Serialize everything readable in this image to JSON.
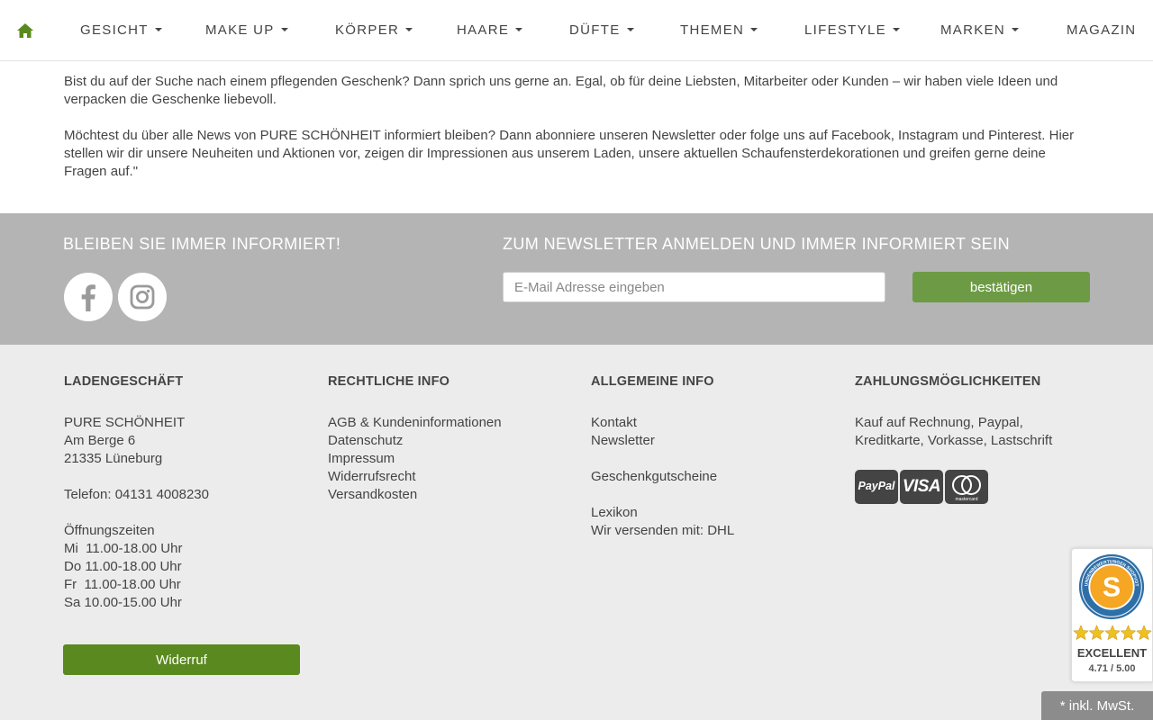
{
  "nav": {
    "home_icon": "home-icon",
    "items": [
      {
        "label": "GESICHT",
        "dropdown": true
      },
      {
        "label": "MAKE UP",
        "dropdown": true
      },
      {
        "label": "KÖRPER",
        "dropdown": true
      },
      {
        "label": "HAARE",
        "dropdown": true
      },
      {
        "label": "DÜFTE",
        "dropdown": true
      },
      {
        "label": "THEMEN",
        "dropdown": true
      },
      {
        "label": "LIFESTYLE",
        "dropdown": true
      },
      {
        "label": "MARKEN",
        "dropdown": true
      },
      {
        "label": "MAGAZIN",
        "dropdown": false
      }
    ]
  },
  "intro": {
    "paragraph1": "Bist du auf der Suche nach einem pflegenden Geschenk? Dann sprich uns gerne an. Egal, ob für deine Liebsten, Mitarbeiter oder Kunden – wir haben viele Ideen und verpacken die Geschenke liebevoll.",
    "paragraph2": "Möchtest du über alle News von PURE SCHÖNHEIT informiert bleiben? Dann abonniere unseren Newsletter oder folge uns auf Facebook, Instagram und Pinterest. Hier stellen wir dir unsere Neuheiten und Aktionen vor, zeigen dir Impressionen aus unserem Laden, unsere aktuellen Schaufensterdekorationen und greifen gerne deine Fragen auf.\""
  },
  "newsletter": {
    "left_title": "BLEIBEN SIE IMMER INFORMIERT!",
    "right_title": "ZUM NEWSLETTER ANMELDEN UND IMMER INFORMIERT SEIN",
    "email_placeholder": "E-Mail Adresse eingeben",
    "email_value": "",
    "submit_label": "bestätigen",
    "social_icons": [
      "facebook-icon",
      "instagram-icon"
    ]
  },
  "footer": {
    "store": {
      "title": "LADENGESCHÄFT",
      "name": "PURE SCHÖNHEIT",
      "street": "Am Berge 6",
      "city": "21335 Lüneburg",
      "phone": "Telefon: 04131 4008230",
      "hours_title": "Öffnungszeiten",
      "hours": [
        "Mi  11.00-18.00 Uhr",
        "Do 11.00-18.00 Uhr",
        "Fr  11.00-18.00 Uhr",
        "Sa 10.00-15.00 Uhr"
      ]
    },
    "legal": {
      "title": "RECHTLICHE INFO",
      "links": [
        "AGB & Kundeninformationen",
        "Datenschutz",
        "Impressum",
        "Widerrufsrecht",
        "Versandkosten"
      ]
    },
    "general": {
      "title": "ALLGEMEINE INFO",
      "contact": "Kontakt",
      "newsletter": "Newsletter",
      "vouchers": "Geschenkgutscheine",
      "lexicon": "Lexikon",
      "shipping": "Wir versenden mit: DHL"
    },
    "payment": {
      "title": "ZAHLUNGSMÖGLICHKEITEN",
      "methods_line1": "Kauf auf Rechnung, Paypal,",
      "methods_line2": "Kreditkarte, Vorkasse, Lastschrift",
      "logos": {
        "paypal": "PayPal",
        "visa": "VISA",
        "mastercard": "mastercard"
      }
    },
    "widerruf_label": "Widerruf"
  },
  "badge": {
    "ring_text": "KUNDENBEWERTUNGEN SHOPVOTE",
    "stars": 5,
    "rating_word": "EXCELLENT",
    "score": "4.71 / 5.00"
  },
  "vat_note": "* inkl. MwSt.",
  "colors": {
    "accent_green": "#6d9b45",
    "dark_green": "#5a8a1f",
    "band_gray": "#b4b4b4",
    "footer_bg": "#ececec",
    "badge_orange": "#f5a623",
    "star_gold": "#f0c020"
  }
}
